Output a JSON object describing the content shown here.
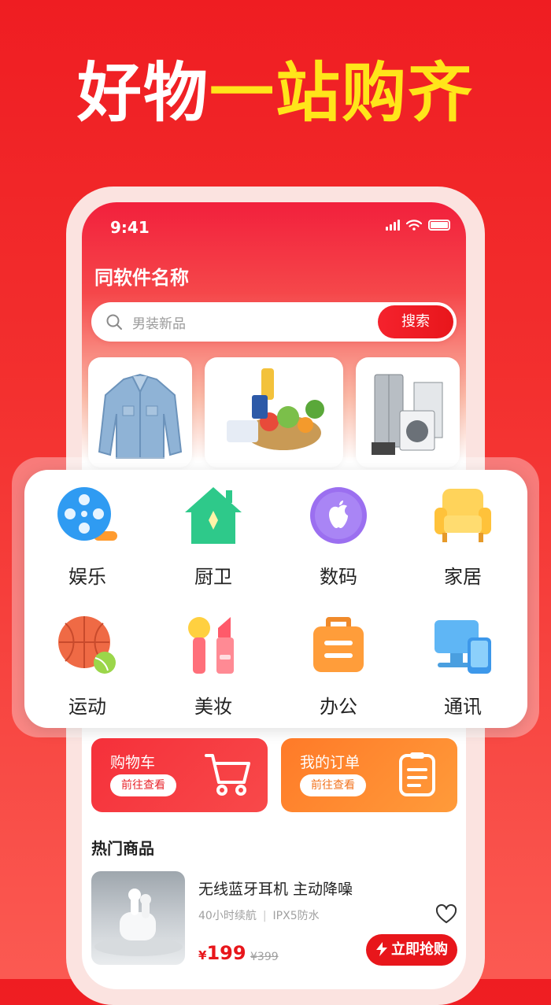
{
  "headline": {
    "white": "好物",
    "yellow": "一站购齐"
  },
  "status": {
    "time": "9:41"
  },
  "app": {
    "title": "同软件名称"
  },
  "search": {
    "placeholder": "男装新品",
    "button": "搜索"
  },
  "categories": [
    {
      "label": "娱乐",
      "icon": "film-reel-icon"
    },
    {
      "label": "厨卫",
      "icon": "house-icon"
    },
    {
      "label": "数码",
      "icon": "apple-logo-icon"
    },
    {
      "label": "家居",
      "icon": "sofa-icon"
    },
    {
      "label": "运动",
      "icon": "basketball-icon"
    },
    {
      "label": "美妆",
      "icon": "lipstick-icon"
    },
    {
      "label": "办公",
      "icon": "briefcase-icon"
    },
    {
      "label": "通讯",
      "icon": "devices-icon"
    }
  ],
  "quick": {
    "cart": {
      "title": "购物车",
      "button": "前往查看",
      "icon": "cart-icon"
    },
    "orders": {
      "title": "我的订单",
      "button": "前往查看",
      "icon": "clipboard-icon"
    }
  },
  "hot": {
    "title": "热门商品",
    "product": {
      "name": "无线蓝牙耳机 主动降噪",
      "tag1": "40小时续航",
      "divider": "|",
      "tag2": "IPX5防水",
      "currency": "¥",
      "price": "199",
      "old_price": "¥399",
      "buy_label": "立即抢购"
    }
  },
  "colors": {
    "brand_red": "#e8161b",
    "headline_yellow": "#ffe51a",
    "orange": "#ff8a30"
  }
}
